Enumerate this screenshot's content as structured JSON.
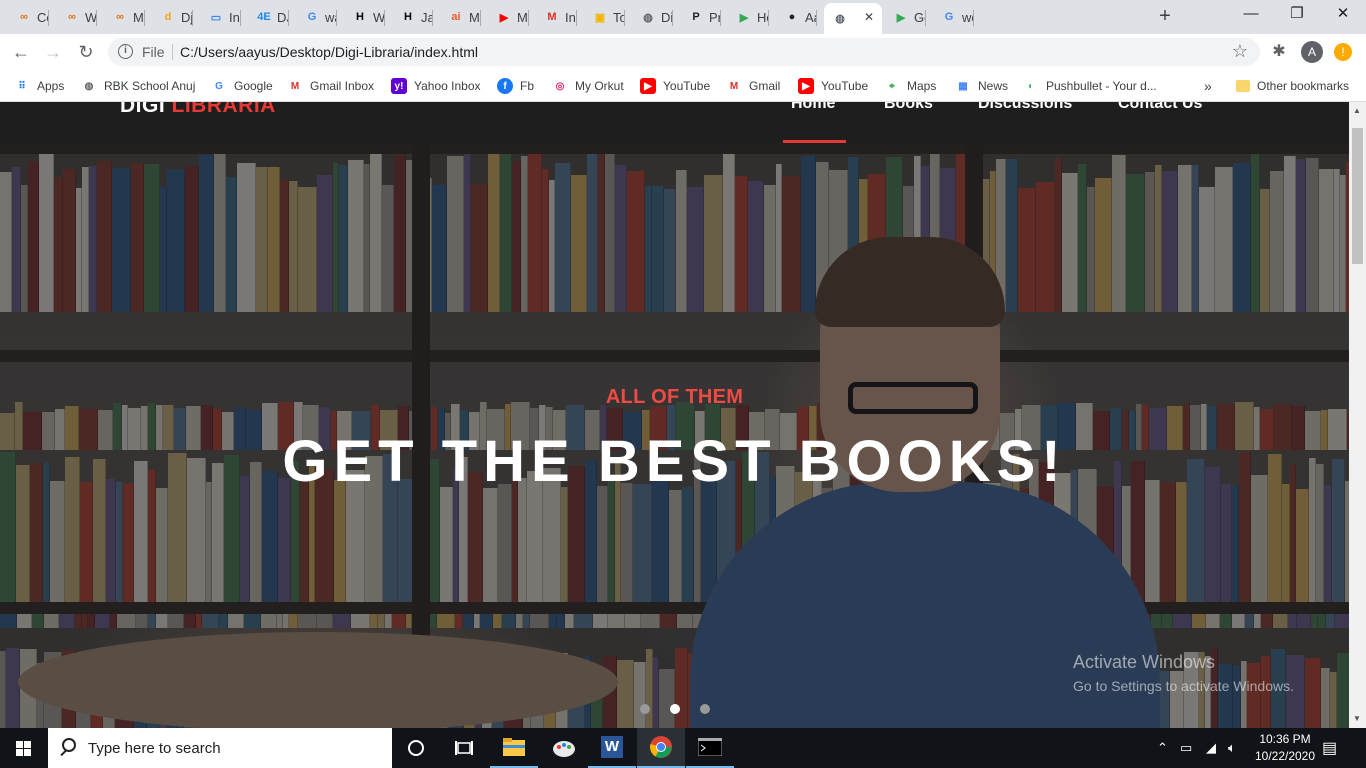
{
  "browser": {
    "tabs": [
      {
        "label": "Co",
        "icon": "colab-icon",
        "color": "#e8710a"
      },
      {
        "label": "We",
        "icon": "colab-icon",
        "color": "#e8710a"
      },
      {
        "label": "Ma",
        "icon": "colab-icon",
        "color": "#e8710a"
      },
      {
        "label": "Dja",
        "icon": "d-icon",
        "color": "#f7a51c"
      },
      {
        "label": "Intr",
        "icon": "book-icon",
        "color": "#4285f4"
      },
      {
        "label": "DJA",
        "icon": "4e-icon",
        "color": "#1e88e5"
      },
      {
        "label": "wa",
        "icon": "google-icon",
        "color": "#4285f4"
      },
      {
        "label": "We",
        "icon": "hackerrank-icon",
        "color": "#000000"
      },
      {
        "label": "Jav",
        "icon": "hackerrank-icon",
        "color": "#000000"
      },
      {
        "label": "ME",
        "icon": "ai-icon",
        "color": "#f15a24"
      },
      {
        "label": "ME",
        "icon": "youtube-icon",
        "color": "#ff0000"
      },
      {
        "label": "Inb",
        "icon": "gmail-icon",
        "color": "#d93025"
      },
      {
        "label": "To-",
        "icon": "classroom-icon",
        "color": "#f4b400"
      },
      {
        "label": "Dig",
        "icon": "globe-icon",
        "color": "#5f6368"
      },
      {
        "label": "Pri",
        "icon": "p-icon",
        "color": "#202124"
      },
      {
        "label": "Ho",
        "icon": "play-icon",
        "color": "#34a853"
      },
      {
        "label": "Aa",
        "icon": "github-icon",
        "color": "#202124"
      },
      {
        "label": "",
        "icon": "globe-icon",
        "color": "#5f6368",
        "active": true
      },
      {
        "label": "Go",
        "icon": "play-icon",
        "color": "#34a853"
      },
      {
        "label": "we",
        "icon": "google-icon",
        "color": "#4285f4"
      }
    ],
    "new_tab": "+",
    "close_tab": "✕",
    "window_controls": {
      "minimize": "—",
      "maximize": "❐",
      "close": "✕"
    },
    "nav": {
      "back": "←",
      "forward": "→",
      "reload": "↻"
    },
    "omnibox": {
      "info": "i",
      "scheme": "File",
      "url": "C:/Users/aayus/Desktop/Digi-Libraria/index.html",
      "star": "☆"
    },
    "profile_initial": "A",
    "update_badge": "!",
    "puzzle": "✱",
    "bookmarks": [
      {
        "label": "Apps",
        "icon": "apps-grid-icon",
        "color": "#1a73e8"
      },
      {
        "label": "RBK School Anuj",
        "icon": "globe-icon",
        "color": "#5f6368"
      },
      {
        "label": "Google",
        "icon": "google-icon",
        "color": "#4285f4"
      },
      {
        "label": "Gmail Inbox",
        "icon": "gmail-icon",
        "color": "#d93025"
      },
      {
        "label": "Yahoo Inbox",
        "icon": "yahoo-icon",
        "color": "#6001d2"
      },
      {
        "label": "Fb",
        "icon": "facebook-icon",
        "color": "#1877f2"
      },
      {
        "label": "My Orkut",
        "icon": "orkut-icon",
        "color": "#e91e63"
      },
      {
        "label": "YouTube",
        "icon": "youtube-icon",
        "color": "#ff0000"
      },
      {
        "label": "Gmail",
        "icon": "gmail-icon",
        "color": "#d93025"
      },
      {
        "label": "YouTube",
        "icon": "youtube-icon",
        "color": "#ff0000"
      },
      {
        "label": "Maps",
        "icon": "maps-icon",
        "color": "#34a853"
      },
      {
        "label": "News",
        "icon": "news-icon",
        "color": "#4285f4"
      },
      {
        "label": "Pushbullet - Your d...",
        "icon": "pushbullet-icon",
        "color": "#4ab367"
      }
    ],
    "more_bookmarks": "»",
    "other_bookmarks": "Other bookmarks"
  },
  "site": {
    "brand_first": "DIGI",
    "brand_second": "LIBRARIA",
    "nav": [
      "Home",
      "Books",
      "Discussions",
      "Contact Us"
    ],
    "active_nav": "Home",
    "kicker": "ALL OF THEM",
    "headline": "GET THE BEST BOOKS!",
    "slides": 3,
    "active_slide": 2,
    "accent": "#e53935"
  },
  "watermark": {
    "title": "Activate Windows",
    "subtitle": "Go to Settings to activate Windows."
  },
  "taskbar": {
    "search_placeholder": "Type here to search",
    "time": "10:36 PM",
    "date": "10/22/2020",
    "word_letter": "W"
  }
}
